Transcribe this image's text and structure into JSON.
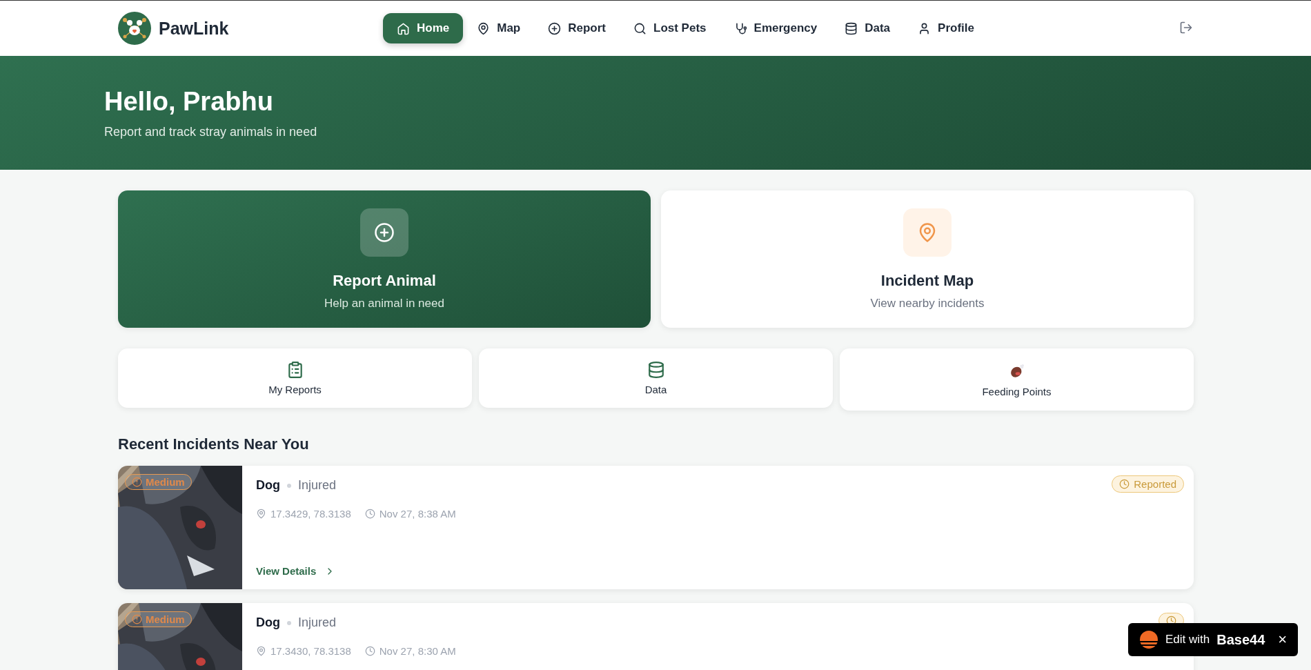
{
  "brand": {
    "name": "PawLink"
  },
  "nav": [
    {
      "label": "Home",
      "selected": true
    },
    {
      "label": "Map",
      "selected": false
    },
    {
      "label": "Report",
      "selected": false
    },
    {
      "label": "Lost Pets",
      "selected": false
    },
    {
      "label": "Emergency",
      "selected": false
    },
    {
      "label": "Data",
      "selected": false
    },
    {
      "label": "Profile",
      "selected": false
    }
  ],
  "hero": {
    "title": "Hello, Prabhu",
    "subtitle": "Report and track stray animals in need"
  },
  "main_actions": [
    {
      "kind": "primary",
      "title": "Report Animal",
      "subtitle": "Help an animal in need"
    },
    {
      "kind": "secondary",
      "title": "Incident Map",
      "subtitle": "View nearby incidents"
    }
  ],
  "quick_links": [
    {
      "label": "My Reports"
    },
    {
      "label": "Data"
    },
    {
      "label": "Feeding Points"
    }
  ],
  "incidents_heading": "Recent Incidents Near You",
  "incidents": [
    {
      "kind": "picture",
      "severity": "Medium",
      "animal": "Dog",
      "condition": "Injured",
      "location": "17.3429, 78.3138",
      "time": "Nov 27, 8:38 AM",
      "status": {
        "kind": "reported",
        "label": "Reported"
      },
      "link": "View Details"
    },
    {
      "kind": "picture",
      "severity": "Medium",
      "animal": "Dog",
      "condition": "Injured",
      "location": "17.3430, 78.3138",
      "time": "Nov 27, 8:30 AM",
      "status": {
        "kind": "reported"
      }
    }
  ],
  "builder_badge": {
    "label": "Edit with",
    "brand": "Base44",
    "close": "×"
  }
}
